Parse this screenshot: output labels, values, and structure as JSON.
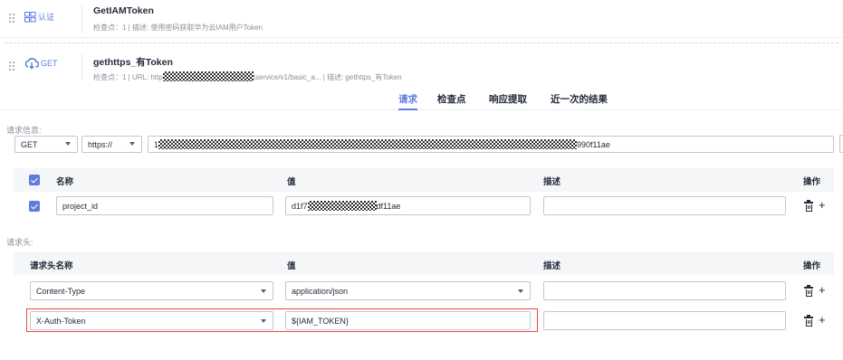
{
  "steps": [
    {
      "icon_label": "认证",
      "title": "GetIAMToken",
      "meta": "检查点：1  |  描述: 使用密码获取华为云IAM用户Token"
    },
    {
      "icon_label": "GET",
      "title": "gethttps_有Token",
      "meta_prefix": "检查点：1  |  URL: http",
      "meta_suffix": "tservice/v1/basic_a...  |  描述: gethttps_有Token"
    }
  ],
  "tabs": [
    {
      "label": "请求",
      "active": true
    },
    {
      "label": "检查点",
      "active": false
    },
    {
      "label": "响应提取",
      "active": false
    },
    {
      "label": "近一次的结果",
      "active": false
    }
  ],
  "request_info": {
    "label": "请求信息:",
    "method": "GET",
    "protocol": "https://",
    "url_prefix": "1",
    "url_suffix": "990f11ae"
  },
  "params": {
    "headers": {
      "name": "名称",
      "value": "值",
      "desc": "描述",
      "action": "操作"
    },
    "rows": [
      {
        "name": "project_id",
        "value_prefix": "d1f7",
        "value_suffix": "df11ae",
        "desc": ""
      }
    ]
  },
  "request_headers": {
    "label": "请求头:",
    "headers": {
      "name": "请求头名称",
      "value": "值",
      "desc": "描述",
      "action": "操作"
    },
    "rows": [
      {
        "name": "Content-Type",
        "value": "application/json",
        "desc": ""
      },
      {
        "name": "X-Auth-Token",
        "value": "${IAM_TOKEN}",
        "desc": ""
      }
    ]
  },
  "icons": {
    "drag": "drag-handle-icon",
    "auth": "grid-auth-icon",
    "get": "cloud-get-icon",
    "delete": "trash-icon",
    "add": "plus-icon"
  },
  "colors": {
    "accent": "#5e7ce0",
    "highlight": "#ee4444"
  }
}
